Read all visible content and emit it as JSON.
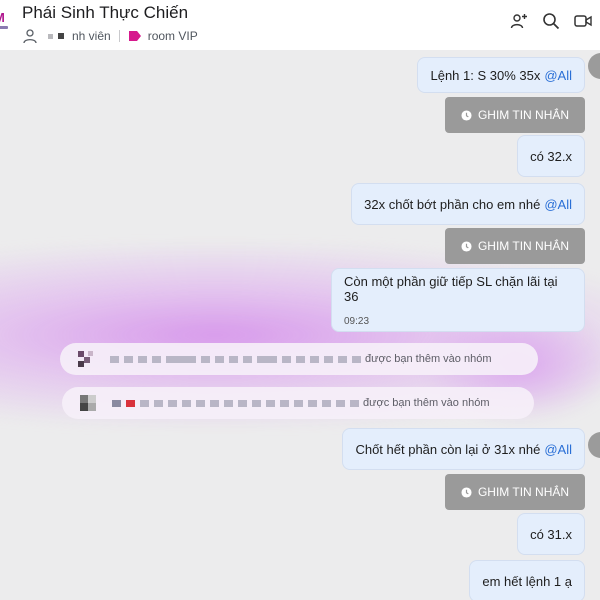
{
  "header": {
    "title": "Phái Sinh Thực Chiến",
    "member_label": "nh viên",
    "tag_label": "room VIP",
    "logo_letter": "M",
    "icons": [
      "add-member-icon",
      "search-icon",
      "video-call-icon"
    ]
  },
  "messages": [
    {
      "type": "text",
      "text": "Lệnh 1: S 30% 35x",
      "mention": "@All"
    },
    {
      "type": "pin",
      "label": "GHIM TIN NHẮN"
    },
    {
      "type": "text",
      "text": "có 32.x"
    },
    {
      "type": "text",
      "text": "32x chốt bớt phần cho em nhé",
      "mention": "@All"
    },
    {
      "type": "pin",
      "label": "GHIM TIN NHẮN"
    },
    {
      "type": "text",
      "text": "Còn một phần giữ tiếp SL chặn lãi tại 36",
      "time": "09:23"
    },
    {
      "type": "system",
      "text": "được bạn thêm vào nhóm"
    },
    {
      "type": "system",
      "text": "được bạn thêm vào nhóm"
    },
    {
      "type": "text",
      "text": "Chốt hết phần còn lại ở 31x nhé",
      "mention": "@All"
    },
    {
      "type": "pin",
      "label": "GHIM TIN NHẮN"
    },
    {
      "type": "text",
      "text": "có 31.x"
    },
    {
      "type": "text",
      "text": "em hết lệnh 1 ạ"
    }
  ],
  "colors": {
    "bubble": "#e4eefc",
    "mention": "#2a6fd6",
    "pin": "#9a9a9a",
    "tag": "#d6198d"
  }
}
